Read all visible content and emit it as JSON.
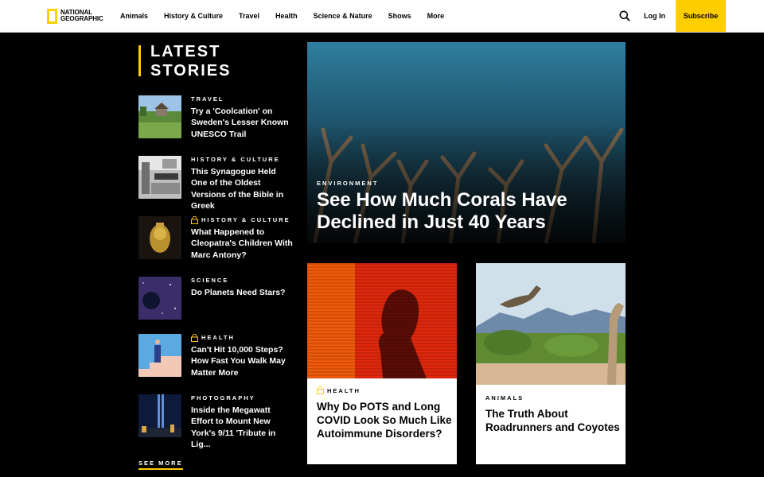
{
  "header": {
    "logo_line1": "NATIONAL",
    "logo_line2": "GEOGRAPHIC",
    "nav": [
      "Animals",
      "History & Culture",
      "Travel",
      "Health",
      "Science & Nature",
      "Shows",
      "More"
    ],
    "search_icon": "search-icon",
    "login_label": "Log In",
    "subscribe_label": "Subscribe",
    "brand_yellow": "#ffce00"
  },
  "latest": {
    "title_line1": "LATEST",
    "title_line2": "STORIES",
    "stories": [
      {
        "category": "TRAVEL",
        "title": "Try a 'Coolcation' on Sweden's Lesser Known UNESCO Trail",
        "locked": false
      },
      {
        "category": "HISTORY & CULTURE",
        "title": "This Synagogue Held One of the Oldest Versions of the Bible in Greek",
        "locked": false
      },
      {
        "category": "HISTORY & CULTURE",
        "title": "What Happened to Cleopatra's Children With Marc Antony?",
        "locked": true
      },
      {
        "category": "SCIENCE",
        "title": "Do Planets Need Stars?",
        "locked": false
      },
      {
        "category": "HEALTH",
        "title": "Can't Hit 10,000 Steps? How Fast You Walk May Matter More",
        "locked": true
      },
      {
        "category": "PHOTOGRAPHY",
        "title": "Inside the Megawatt Effort to Mount New York's 9/11 'Tribute in Lig...",
        "locked": false
      }
    ],
    "see_more": "SEE MORE"
  },
  "hero": {
    "category": "ENVIRONMENT",
    "title": "See How Much Corals Have Declined in Just 40 Years"
  },
  "cards": [
    {
      "category": "HEALTH",
      "title": "Why Do POTS and Long COVID Look So Much Like Autoimmune Disorders?",
      "locked": true
    },
    {
      "category": "ANIMALS",
      "title": "The Truth About Roadrunners and Coyotes",
      "locked": false
    }
  ]
}
